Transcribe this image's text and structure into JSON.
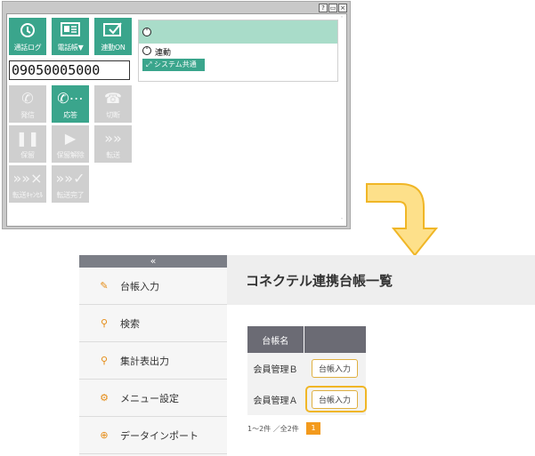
{
  "softphone": {
    "titlebar_buttons": [
      "?",
      "▭",
      "×"
    ],
    "tiles_top": [
      {
        "label": "通話ログ",
        "icon": "call-log-icon"
      },
      {
        "label": "電話帳▼",
        "icon": "phonebook-icon"
      },
      {
        "label": "連動ON",
        "icon": "link-check-icon"
      }
    ],
    "phone_number": "09050005000",
    "call_buttons": [
      {
        "label": "発信",
        "state": "disabled"
      },
      {
        "label": "応答",
        "state": "active"
      },
      {
        "label": "切断",
        "state": "disabled"
      },
      {
        "label": "保留",
        "state": "disabled"
      },
      {
        "label": "保留解除",
        "state": "disabled"
      },
      {
        "label": "転送",
        "state": "disabled"
      },
      {
        "label": "転送ｷｬﾝｾﾙ",
        "state": "disabled"
      },
      {
        "label": "転送完了",
        "state": "disabled"
      }
    ],
    "panel": {
      "renkei_label": "連動",
      "system_button": "システム共通"
    },
    "colors": {
      "accent": "#3aa58c",
      "band": "#a9dcc9",
      "disabled": "#cfcfcf"
    }
  },
  "webapp": {
    "collapse_label": "«",
    "menu": [
      {
        "label": "台帳入力",
        "icon": "pencil-icon"
      },
      {
        "label": "検索",
        "icon": "search-icon"
      },
      {
        "label": "集計表出力",
        "icon": "search-icon"
      },
      {
        "label": "メニュー設定",
        "icon": "gear-icon"
      },
      {
        "label": "データインポート",
        "icon": "import-icon"
      }
    ],
    "page_title": "コネクテル連携台帳一覧",
    "table": {
      "headers": [
        "台帳名",
        ""
      ],
      "rows": [
        {
          "name": "会員管理Ｂ",
          "action": "台帳入力"
        },
        {
          "name": "会員管理Ａ",
          "action": "台帳入力"
        }
      ]
    },
    "pagination": {
      "info": "1〜2件 ／全2件",
      "current_page": "1"
    },
    "colors": {
      "accent": "#f39a1d",
      "header": "#6b6b74"
    }
  }
}
